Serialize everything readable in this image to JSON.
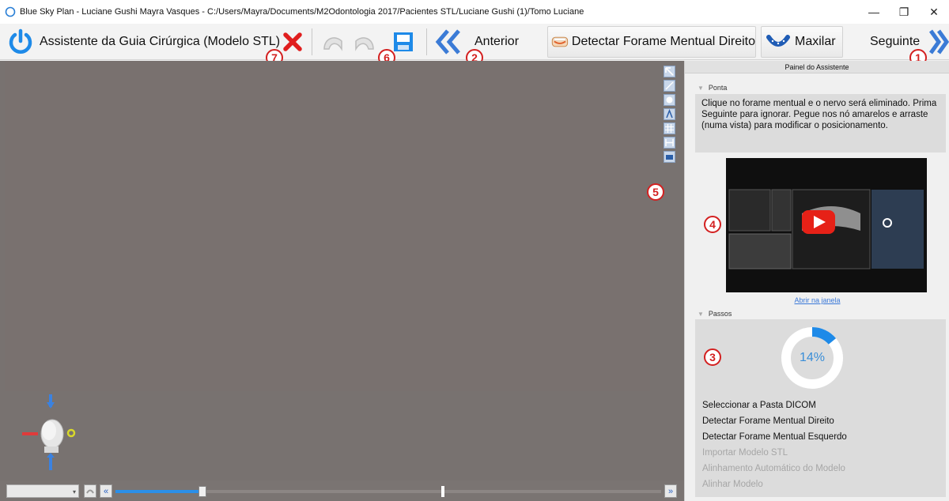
{
  "window": {
    "title": "Blue Sky Plan - Luciane Gushi Mayra Vasques - C:/Users/Mayra/Documents/M2Odontologia 2017/Pacientes STL/Luciane Gushi (1)/Tomo Luciane",
    "minimize": "—",
    "restore": "❐",
    "close": "✕"
  },
  "toolbar": {
    "wizard_label": "Assistente da Guia Cirúrgica (Modelo STL)",
    "previous_label": "Anterior",
    "detect_label": "Detectar Forame Mentual Direito",
    "jaw_label": "Maxilar",
    "next_label": "Seguinte"
  },
  "badges": [
    "1",
    "2",
    "3",
    "4",
    "5",
    "6",
    "7"
  ],
  "panel": {
    "header": "Painel do Assistente",
    "tip_section": "Ponta",
    "tip_text": "Clique no forame mentual e o nervo será eliminado. Prima Seguinte para ignorar. Pegue nos nó amarelos e arraste (numa vista) para modificar o posicionamento.",
    "open_window_link": "Abrir na janela",
    "steps_section": "Passos",
    "progress_text": "14%",
    "progress_fraction": 0.14,
    "steps": [
      {
        "label": "Seleccionar a Pasta DICOM",
        "done": true
      },
      {
        "label": "Detectar Forame Mentual Direito",
        "done": true
      },
      {
        "label": "Detectar Forame Mentual Esquerdo",
        "done": true
      },
      {
        "label": "Importar Modelo STL",
        "done": false
      },
      {
        "label": "Alinhamento Automático do Modelo",
        "done": false
      },
      {
        "label": "Alinhar Modelo",
        "done": false
      }
    ]
  },
  "viewport": {
    "slider_fraction": 0.16
  },
  "colors": {
    "accent": "#1e8ae8",
    "badge": "#d32020",
    "viewport": "#787270"
  },
  "icons": [
    "app-logo-icon",
    "power-icon",
    "close-x-icon",
    "undo-icon",
    "redo-icon",
    "save-icon",
    "double-chevron-left-icon",
    "jaw-panoramic-icon",
    "maxilla-icon",
    "double-chevron-right-icon",
    "play-icon",
    "head-orientation-icon"
  ]
}
